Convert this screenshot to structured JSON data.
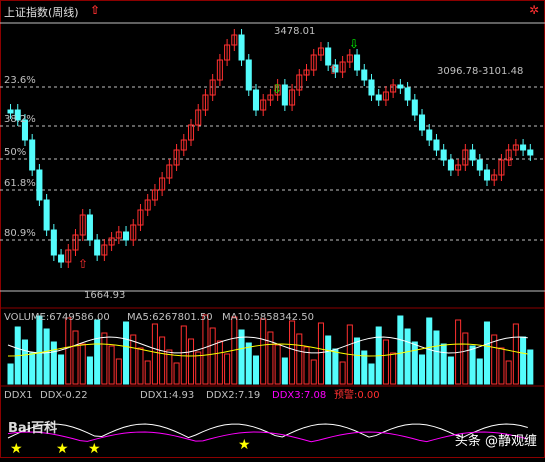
{
  "header": {
    "title": "上证指数(周线)"
  },
  "fib_levels": [
    {
      "label": "23.6%",
      "name": "fib-23"
    },
    {
      "label": "38.2%",
      "name": "fib-38"
    },
    {
      "label": "50%",
      "name": "fib-50"
    },
    {
      "label": "61.8%",
      "name": "fib-61"
    },
    {
      "label": "80.9%",
      "name": "fib-80"
    }
  ],
  "annotations": {
    "high": "3478.01",
    "low": "1664.93",
    "range": "3096.78-3101.48"
  },
  "volume_line": {
    "volume": "VOLUME:6749586.00",
    "ma5": "MA5:6267801.50",
    "ma10": "MA10:5858342.50"
  },
  "ddx_line": {
    "ddx1_label": "DDX1",
    "ddx": "DDX-0.22",
    "ddx1": "DDX1:4.93",
    "ddx2": "DDX2:7.19",
    "ddx3": "DDX3:7.08",
    "alert": "预警:0.00"
  },
  "watermarks": {
    "left": "Bai百科",
    "right": "头条 @静观缠"
  },
  "colors": {
    "up": "#ff3030",
    "down": "#54fcfc",
    "fib": "#c0c0c0",
    "ma5": "#ffffff",
    "ma10": "#ffff00",
    "ddx3": "#ff00ff",
    "alert": "#ff3030"
  }
}
